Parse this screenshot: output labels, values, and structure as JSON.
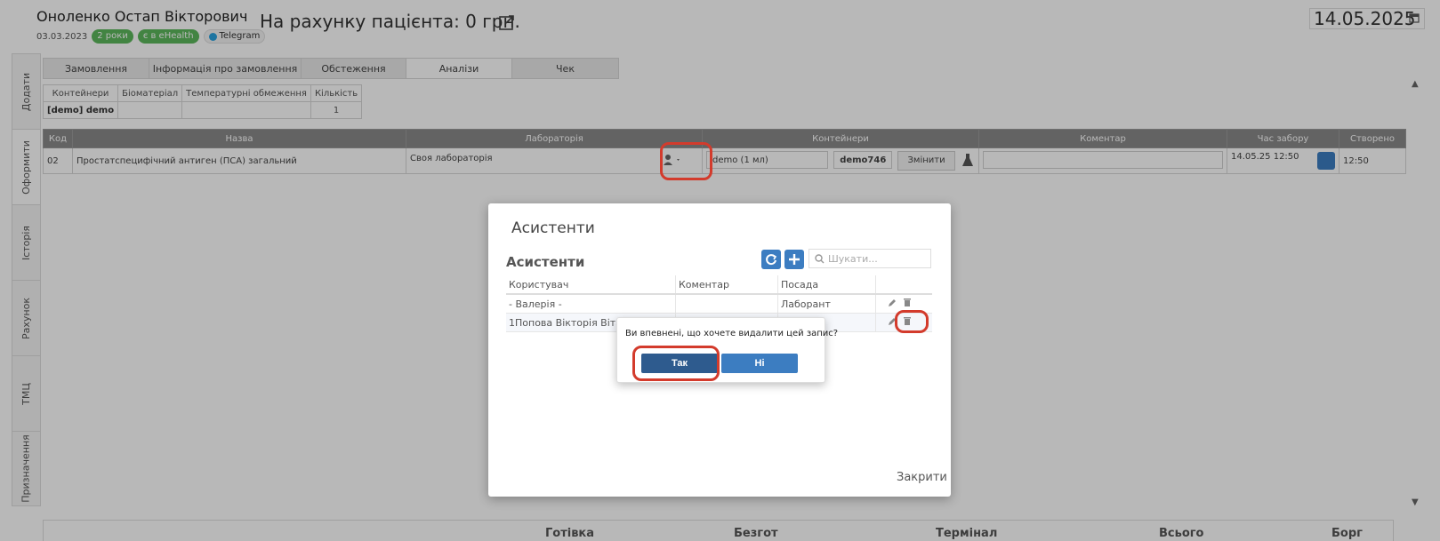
{
  "header": {
    "patient_name": "Оноленко Остап Вікторович",
    "birth_date": "03.03.2023",
    "age_badge": "2 роки",
    "ehealth_badge": "є в eHealth",
    "telegram_badge": "Telegram",
    "balance": "На рахунку пацієнта: 0 грн.",
    "date": "14.05.2025"
  },
  "side_tabs": [
    "Додати",
    "Оформити",
    "Історія",
    "Рахунок",
    "ТМЦ",
    "Призначення"
  ],
  "order_tabs": [
    "Замовлення",
    "Інформація про замовлення",
    "Обстеження",
    "Аналізи",
    "Чек"
  ],
  "containers_table": {
    "headers": [
      "Контейнери",
      "Біоматеріал",
      "Температурні обмеження",
      "Кількість"
    ],
    "row": [
      "[demo] demo",
      "",
      "",
      "1"
    ]
  },
  "orders_table": {
    "headers": [
      "Код",
      "Назва",
      "Лабораторія",
      "Контейнери",
      "Коментар",
      "Час забору",
      "Створено"
    ],
    "row": {
      "code": "02",
      "name": "Простатспецифічний антиген (ПСА) загальний",
      "lab": "Своя лабораторія",
      "container_select": "demo (1 мл)",
      "container_code": "demo746",
      "change_button": "Змінити",
      "time": "14.05.25 12:50",
      "created": "12:50"
    }
  },
  "summary": [
    "Готівка",
    "Безгот",
    "Термінал",
    "Всього",
    "Борг"
  ],
  "modal": {
    "title": "Асистенти",
    "subtitle": "Асистенти",
    "search_placeholder": "Шукати...",
    "table": {
      "headers": [
        "Користувач",
        "Коментар",
        "Посада"
      ],
      "rows": [
        {
          "user": "- Валерія -",
          "comment": "",
          "position": "Лаборант"
        },
        {
          "user": "1Попова Вікторія Віталіївна",
          "comment": "",
          "position": ""
        }
      ]
    },
    "close_label": "Закрити"
  },
  "confirm": {
    "message": "Ви впевнені, що хочете видалити цей запис?",
    "yes_label": "Так",
    "no_label": "Ні"
  },
  "colors": {
    "accent": "#3c7dc1",
    "highlight": "#d33b2c",
    "success": "#5cb85c"
  }
}
